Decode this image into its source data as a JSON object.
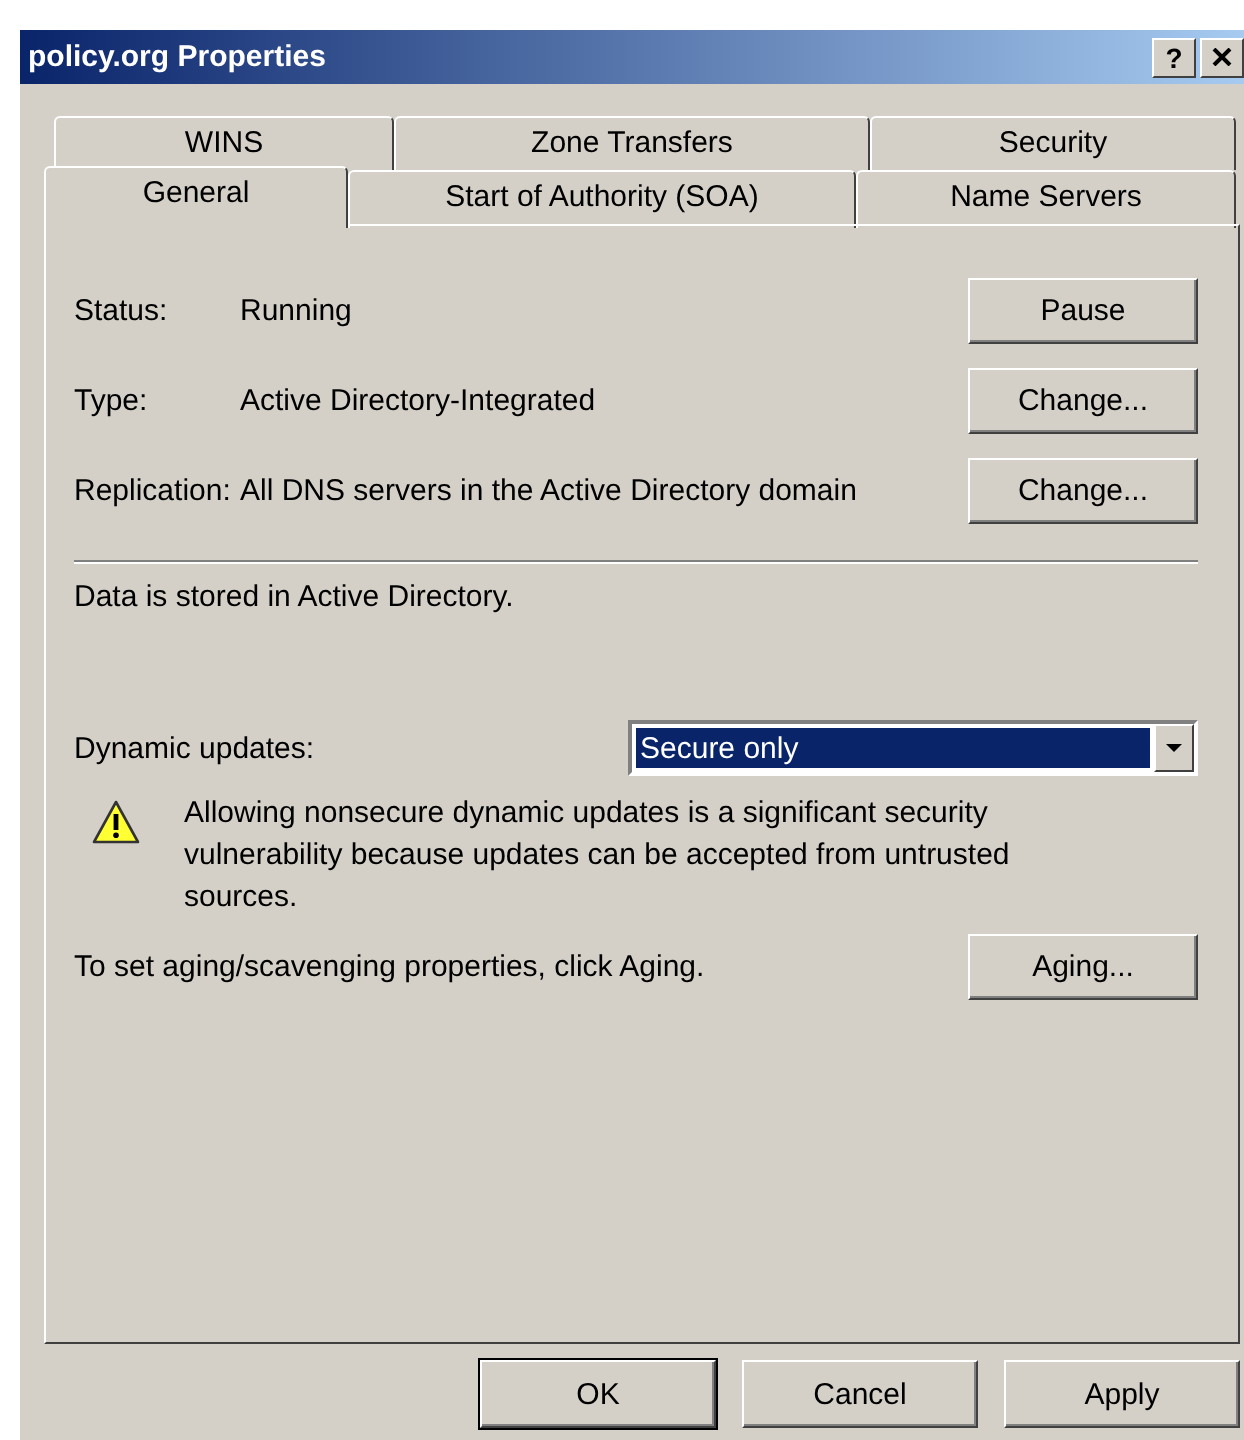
{
  "window": {
    "title": "policy.org Properties",
    "help_button": "?"
  },
  "tab_rows": [
    [
      {
        "label": "WINS",
        "selected": false
      },
      {
        "label": "Zone Transfers",
        "selected": false
      },
      {
        "label": "Security",
        "selected": false
      }
    ],
    [
      {
        "label": "General",
        "selected": true
      },
      {
        "label": "Start of Authority (SOA)",
        "selected": false
      },
      {
        "label": "Name Servers",
        "selected": false
      }
    ]
  ],
  "fields": [
    {
      "label": "Status:",
      "value": "Running",
      "button": "Pause"
    },
    {
      "label": "Type:",
      "value": "Active Directory-Integrated",
      "button": "Change..."
    },
    {
      "label": "Replication:",
      "value": "All DNS servers in the Active Directory domain",
      "button": "Change..."
    }
  ],
  "storage_note": "Data is stored in Active Directory.",
  "dynamic_updates": {
    "label": "Dynamic updates:",
    "value": "Secure only"
  },
  "warning": "Allowing nonsecure dynamic updates is a significant security vulnerability because updates can be accepted from untrusted sources.",
  "aging": {
    "text": "To set aging/scavenging properties, click Aging.",
    "button": "Aging..."
  },
  "buttons": [
    {
      "label": "OK",
      "default": true
    },
    {
      "label": "Cancel",
      "default": false
    },
    {
      "label": "Apply",
      "default": false
    }
  ]
}
